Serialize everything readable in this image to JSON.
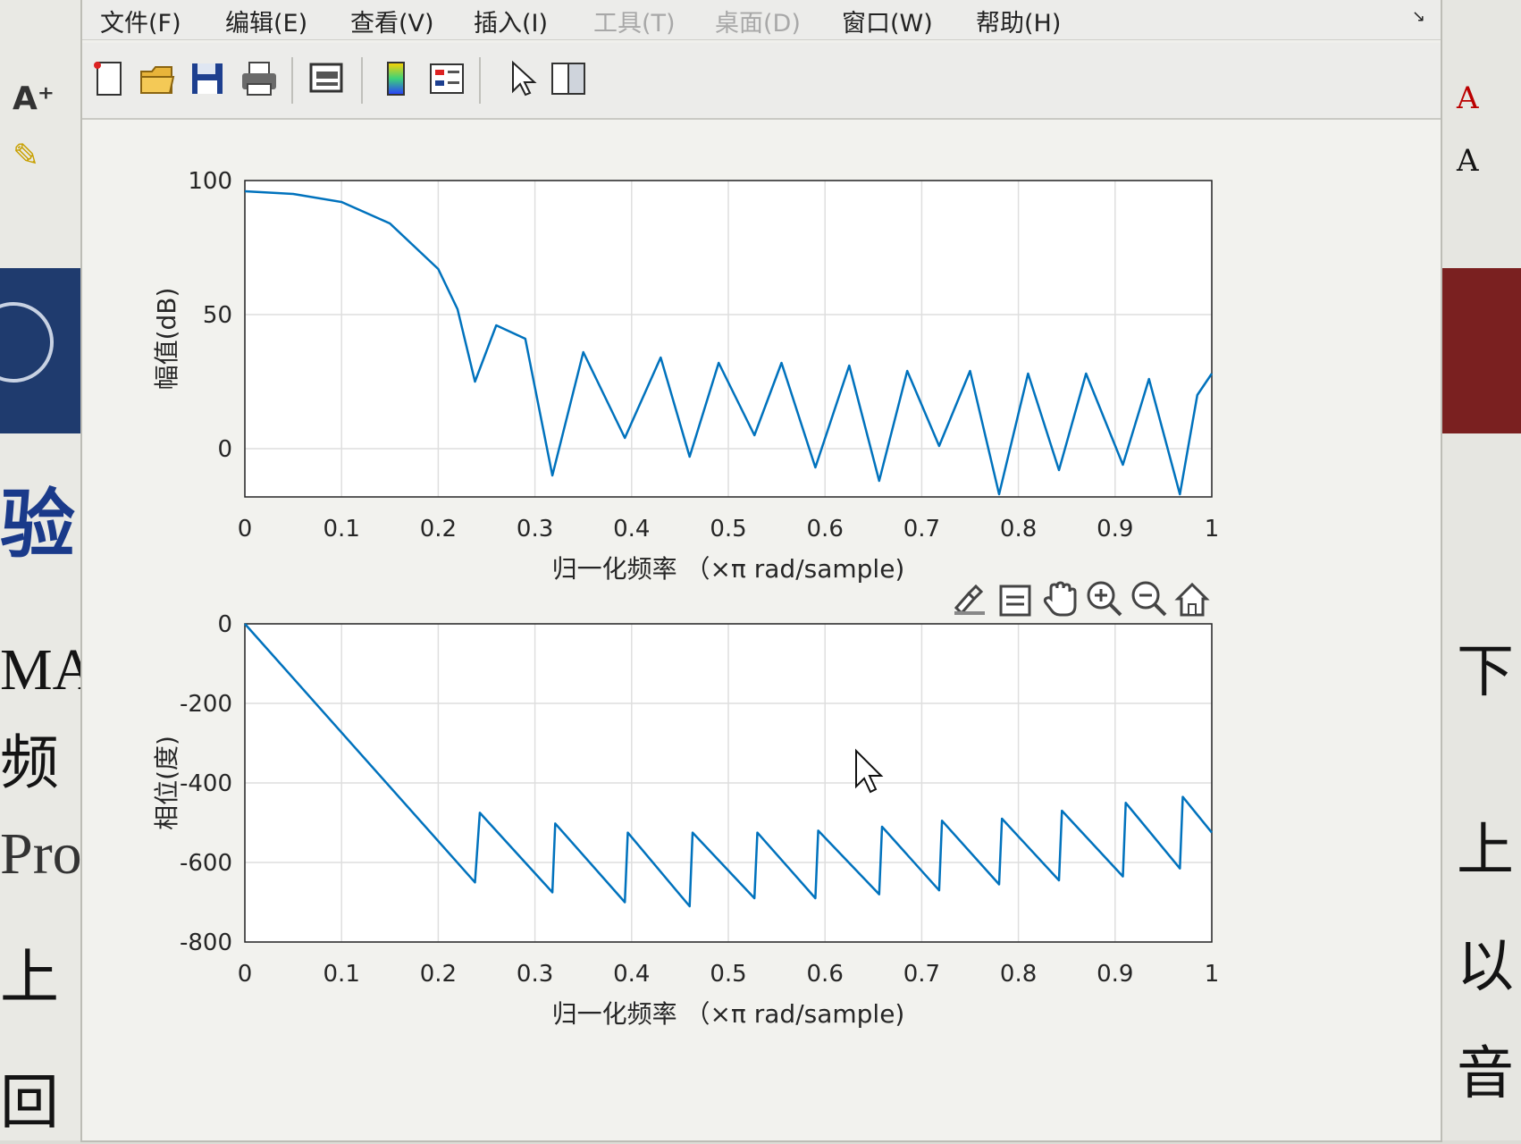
{
  "window": {
    "menus": [
      {
        "label": "文件(F)",
        "enabled": true
      },
      {
        "label": "编辑(E)",
        "enabled": true
      },
      {
        "label": "查看(V)",
        "enabled": true
      },
      {
        "label": "插入(I)",
        "enabled": true
      },
      {
        "label": "工具(T)",
        "enabled": false
      },
      {
        "label": "桌面(D)",
        "enabled": false
      },
      {
        "label": "窗口(W)",
        "enabled": true
      },
      {
        "label": "帮助(H)",
        "enabled": true
      }
    ],
    "toolbar": [
      "new-figure-icon",
      "open-file-icon",
      "save-icon",
      "print-icon",
      "print-preview-icon",
      "insert-colorbar-icon",
      "insert-legend-icon",
      "edit-plot-icon",
      "show-plot-tools-icon"
    ],
    "axes_toolbar": [
      "brush-icon",
      "data-tips-icon",
      "pan-icon",
      "zoom-in-icon",
      "zoom-out-icon",
      "restore-view-icon"
    ]
  },
  "background": {
    "left_lines": [
      "验",
      "MAT",
      "频",
      "Pro",
      "上",
      "回"
    ],
    "right_lines": [
      "下",
      "上",
      "以",
      "音"
    ]
  },
  "chart_data": [
    {
      "type": "line",
      "xlabel": "归一化频率 （×π rad/sample)",
      "ylabel": "幅值(dB)",
      "xlim": [
        0,
        1
      ],
      "ylim": [
        -18,
        100
      ],
      "xticks": [
        "0",
        "0.1",
        "0.2",
        "0.3",
        "0.4",
        "0.5",
        "0.6",
        "0.7",
        "0.8",
        "0.9",
        "1"
      ],
      "yticks": [
        "100",
        "50",
        "0"
      ],
      "grid": true,
      "color": "#0072bd",
      "series": [
        {
          "x": [
            0,
            0.05,
            0.1,
            0.15,
            0.2,
            0.22,
            0.238,
            0.26,
            0.29,
            0.318,
            0.35,
            0.393,
            0.43,
            0.46,
            0.49,
            0.527,
            0.555,
            0.59,
            0.625,
            0.656,
            0.685,
            0.718,
            0.75,
            0.78,
            0.81,
            0.842,
            0.87,
            0.908,
            0.935,
            0.967,
            0.985,
            1
          ],
          "y": [
            96,
            95,
            92,
            84,
            67,
            52,
            25,
            46,
            41,
            -10,
            36,
            4,
            34,
            -3,
            32,
            5,
            32,
            -7,
            31,
            -12,
            29,
            1,
            29,
            -17,
            28,
            -8,
            28,
            -6,
            26,
            -17,
            20,
            28
          ]
        }
      ]
    },
    {
      "type": "line",
      "xlabel": "归一化频率 （×π rad/sample)",
      "ylabel": "相位(度)",
      "xlim": [
        0,
        1
      ],
      "ylim": [
        -800,
        0
      ],
      "xticks": [
        "0",
        "0.1",
        "0.2",
        "0.3",
        "0.4",
        "0.5",
        "0.6",
        "0.7",
        "0.8",
        "0.9",
        "1"
      ],
      "yticks": [
        "0",
        "-200",
        "-400",
        "-600",
        "-800"
      ],
      "grid": true,
      "color": "#0072bd",
      "series": [
        {
          "x": [
            0,
            0.238,
            0.243,
            0.318,
            0.321,
            0.393,
            0.396,
            0.46,
            0.463,
            0.527,
            0.53,
            0.59,
            0.593,
            0.656,
            0.659,
            0.718,
            0.721,
            0.78,
            0.783,
            0.842,
            0.845,
            0.908,
            0.911,
            0.967,
            0.97,
            1
          ],
          "y": [
            0,
            -650,
            -475,
            -675,
            -502,
            -700,
            -525,
            -710,
            -525,
            -690,
            -525,
            -690,
            -520,
            -680,
            -510,
            -670,
            -495,
            -655,
            -490,
            -645,
            -470,
            -635,
            -450,
            -615,
            -435,
            -525
          ]
        }
      ]
    }
  ]
}
